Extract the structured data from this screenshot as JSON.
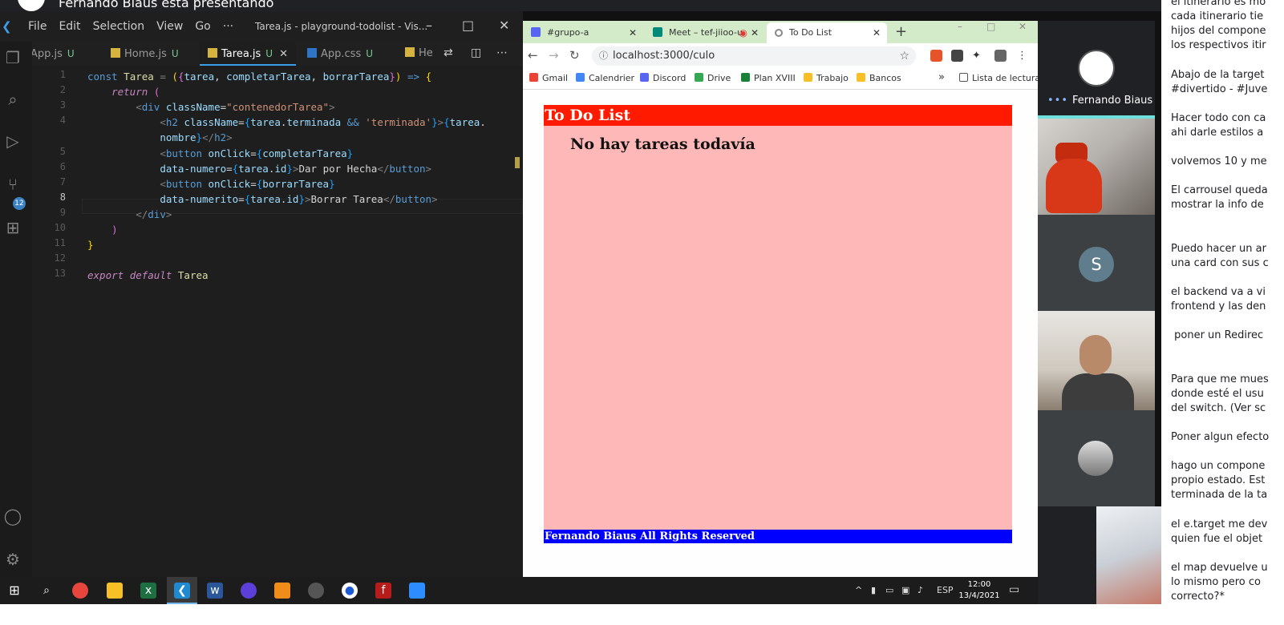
{
  "meet": {
    "presenting_text": "Fernando Biaus está presentando",
    "self_name": "Fernando Biaus",
    "participant_letter": "S"
  },
  "vscode": {
    "window_title": "Tarea.js - playground-todolist - Vis...",
    "menu": [
      "File",
      "Edit",
      "Selection",
      "View",
      "Go",
      "···"
    ],
    "tabs": [
      {
        "label": "App.js",
        "status": "U"
      },
      {
        "label": "Home.js",
        "status": "U"
      },
      {
        "label": "Tarea.js",
        "status": "U",
        "active": true
      },
      {
        "label": "App.css",
        "status": "U"
      },
      {
        "label": "He",
        "status": ""
      }
    ],
    "source_control_badge": "12",
    "line_numbers": [
      "1",
      "2",
      "3",
      "4",
      "",
      "5",
      "6",
      "7",
      "8",
      "9",
      "10",
      "11",
      "12",
      "13"
    ]
  },
  "chrome": {
    "tabs": [
      {
        "label": "#grupo-a",
        "color": "#5865f2"
      },
      {
        "label": "Meet – tef-jiioo-u",
        "color": "#00897b"
      },
      {
        "label": "To Do List",
        "color": "#888888"
      }
    ],
    "url": "localhost:3000/culo",
    "bookmarks": [
      {
        "label": "Gmail",
        "color": "#ea4335"
      },
      {
        "label": "Calendrier",
        "color": "#4285f4"
      },
      {
        "label": "Discord",
        "color": "#5865f2"
      },
      {
        "label": "Drive",
        "color": "#34a853"
      },
      {
        "label": "Plan XVIII",
        "color": "#188038"
      },
      {
        "label": "Trabajo",
        "color": "#f6c026"
      },
      {
        "label": "Bancos",
        "color": "#f6c026"
      }
    ],
    "bookmarks_more": "»",
    "reading_list": "Lista de lectura"
  },
  "todo_app": {
    "header": "To Do List",
    "empty_message": "No hay tareas todavía",
    "footer": "Fernando Biaus All Rights Reserved",
    "colors": {
      "header": "#ff1a00",
      "body": "#ffb8b8",
      "footer": "#0000ff"
    }
  },
  "chat": {
    "messages": [
      "el itinerario es mo",
      "cada itinerario tie",
      "hijos del compone",
      "los respectivos itir",
      "",
      "Abajo de la target",
      "#divertido - #Juve",
      "",
      "Hacer todo con ca",
      "ahi darle estilos a",
      "",
      "volvemos 10 y me",
      "",
      "El carrousel queda",
      "mostrar la info de",
      "",
      "",
      "Puedo hacer un ar",
      "una card con sus c",
      "",
      "el backend va a vi",
      "frontend y las den",
      "",
      " poner un Redirec",
      "",
      "",
      "Para que me mues",
      "donde esté el usu",
      "del switch. (Ver sc",
      "",
      "Poner algun efecto",
      "",
      "hago un compone",
      "propio estado. Est",
      "terminada de la ta",
      "",
      "el e.target me dev",
      "quien fue el objet",
      "",
      "el map devuelve u",
      "lo mismo pero co",
      "correcto?*"
    ]
  },
  "taskbar": {
    "language": "ESP",
    "time": "12:00",
    "date": "13/4/2021"
  }
}
